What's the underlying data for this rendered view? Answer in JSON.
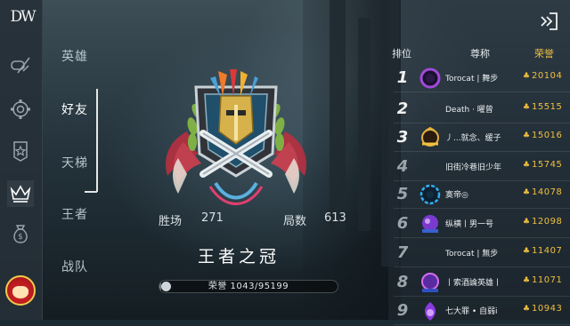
{
  "app": {
    "logo": "DW"
  },
  "rail": {
    "icons": [
      "gamepad-sword-icon",
      "gear-frame-icon",
      "star-badge-icon",
      "crown-icon",
      "money-bag-icon"
    ]
  },
  "menu": {
    "items": [
      {
        "label": "英雄",
        "active": false
      },
      {
        "label": "好友",
        "active": true
      },
      {
        "label": "天梯",
        "active": false
      },
      {
        "label": "王者",
        "active": false
      },
      {
        "label": "战队",
        "active": false
      }
    ]
  },
  "player": {
    "wins_label": "胜场",
    "wins": "271",
    "games_label": "局数",
    "games": "613",
    "rank_title": "王者之冠",
    "honor_label": "荣誉",
    "honor_value": "1043/95199",
    "honor_progress": 0.011
  },
  "leaderboard": {
    "headers": {
      "rank": "排位",
      "title": "尊称",
      "honor": "荣誉"
    },
    "rows": [
      {
        "rank": "1",
        "name": "Torocat | 舞步",
        "score": "20104",
        "avatar": "purple-ring"
      },
      {
        "rank": "2",
        "name": "Death · 曜曾",
        "score": "15515",
        "avatar": "none"
      },
      {
        "rank": "3",
        "name": "丿...就念、缓子",
        "score": "15016",
        "avatar": "gold-crest"
      },
      {
        "rank": "4",
        "name": "旧街冷巷旧少年",
        "score": "15745",
        "avatar": "none"
      },
      {
        "rank": "5",
        "name": "寞帝◎",
        "score": "14078",
        "avatar": "blue-ring"
      },
      {
        "rank": "6",
        "name": "纵横丨男一号",
        "score": "12098",
        "avatar": "purple-orb"
      },
      {
        "rank": "7",
        "name": "Torocat | 無步",
        "score": "11407",
        "avatar": "none"
      },
      {
        "rank": "8",
        "name": "丨索酒論英雄丨",
        "score": "11071",
        "avatar": "purple-crest"
      },
      {
        "rank": "9",
        "name": "七大罪 • 自弱i",
        "score": "10943",
        "avatar": "purple-flame"
      }
    ]
  },
  "colors": {
    "gold": "#f0c040",
    "panel": "#263038"
  }
}
